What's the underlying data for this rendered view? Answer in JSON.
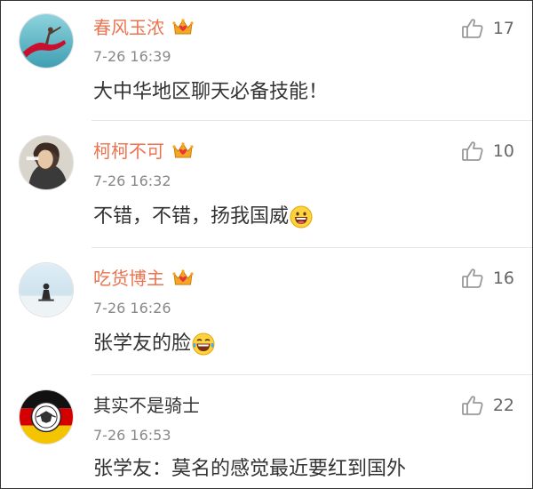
{
  "colors": {
    "vip_name": "#eb7350",
    "plain_name": "#333333",
    "meta": "#888888",
    "divider": "#e6e6e6"
  },
  "comments": [
    {
      "author": "春风玉浓",
      "vip": true,
      "badge_icon": "vip-crown-icon",
      "time": "7-26 16:39",
      "text": "大中华地区聊天必备技能！",
      "emoji": "",
      "likes": "17",
      "avatar_icon": "dancer-avatar"
    },
    {
      "author": "柯柯不可",
      "vip": true,
      "badge_icon": "vip-crown-icon",
      "time": "7-26 16:32",
      "text": "不错，不错，扬我国威",
      "emoji": "grinning-face-icon",
      "likes": "10",
      "avatar_icon": "portrait-avatar"
    },
    {
      "author": "吃货博主",
      "vip": true,
      "badge_icon": "vip-crown-icon",
      "time": "7-26 16:26",
      "text": "张学友的脸",
      "emoji": "laughing-tears-icon",
      "likes": "16",
      "avatar_icon": "seated-figure-avatar"
    },
    {
      "author": "其实不是骑士",
      "vip": false,
      "badge_icon": "",
      "time": "7-26 16:53",
      "text": "张学友：莫名的感觉最近要红到国外",
      "emoji": "",
      "likes": "22",
      "avatar_icon": "emblem-avatar"
    }
  ]
}
